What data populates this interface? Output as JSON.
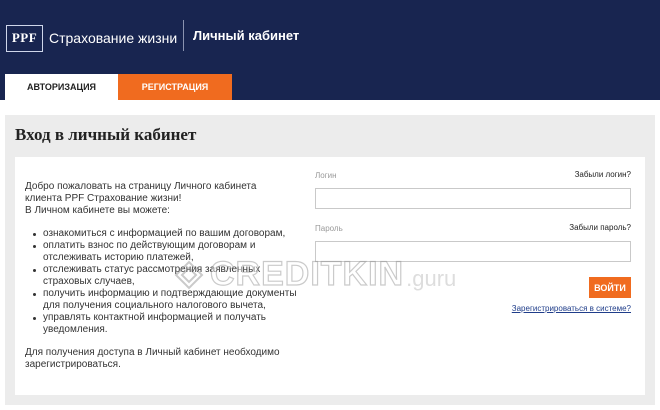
{
  "header": {
    "logo_text": "PPF",
    "brand_name": "Страхование жизни",
    "cabinet_title": "Личный кабинет",
    "background_color": "#182550"
  },
  "tabs": [
    {
      "label": "Авторизация",
      "active": true
    },
    {
      "label": "Регистрация",
      "active": false
    }
  ],
  "page": {
    "title": "Вход в личный кабинет"
  },
  "info": {
    "intro_lines": [
      "Добро пожаловать на страницу Личного кабинета",
      "клиента PPF Страхование жизни!",
      "В Личном кабинете вы можете:"
    ],
    "bullets": [
      "ознакомиться с информацией по вашим договорам,",
      "оплатить взнос по действующим договорам и отслеживать историю платежей,",
      "отслеживать статус рассмотрения заявленных страховых случаев,",
      "получить информацию и подтверждающие документы для получения социального налогового вычета,",
      "управлять контактной информацией и получать уведомления."
    ],
    "footer_note": "Для получения доступа в Личный кабинет необходимо зарегистрироваться."
  },
  "form": {
    "login_label": "Логин",
    "forgot_login": "Забыли логин?",
    "login_value": "",
    "password_label": "Пароль",
    "forgot_password": "Забыли пароль?",
    "password_value": "",
    "submit_label": "Войти",
    "register_link": "Зарегистрироваться в системе?"
  },
  "watermark": {
    "text": "CREDITKIN",
    "suffix": ".guru"
  },
  "colors": {
    "accent": "#f06b1f",
    "navy": "#182550",
    "panel": "#ececec"
  }
}
